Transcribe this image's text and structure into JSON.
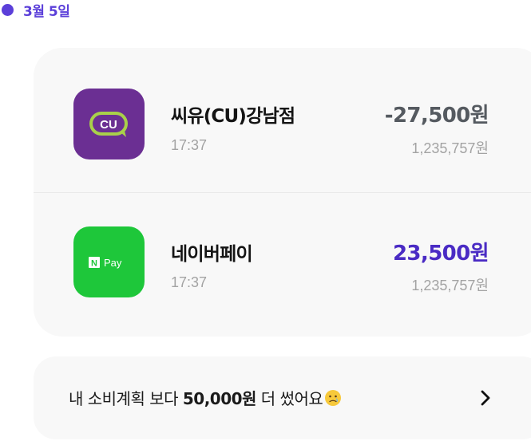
{
  "date_header": {
    "label": "3월 5일"
  },
  "colors": {
    "accent": "#5b3fd9",
    "income_amount": "#4a2bc4",
    "expense_amount": "#555a60",
    "cu_brand": "#6b2f93",
    "naverpay_brand": "#1ec73a"
  },
  "transactions": [
    {
      "icon": "cu-logo-icon",
      "icon_text": "CU",
      "merchant": "씨유(CU)강남점",
      "time": "17:37",
      "amount": "-27,500원",
      "balance": "1,235,757원"
    },
    {
      "icon": "naver-pay-logo-icon",
      "icon_badge": "N",
      "icon_text": "Pay",
      "merchant": "네이버페이",
      "time": "17:37",
      "amount": "23,500원",
      "balance": "1,235,757원"
    }
  ],
  "budget_banner": {
    "prefix": "내 소비계획 보다 ",
    "highlight": "50,000원",
    "suffix": " 더 썼어요",
    "emoji_icon": "crying-face-icon",
    "arrow_icon": "chevron-right-icon"
  }
}
